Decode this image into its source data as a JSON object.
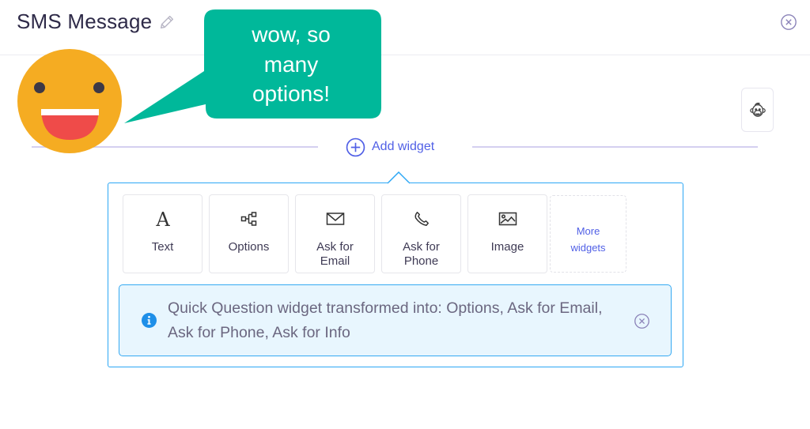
{
  "header": {
    "title": "SMS Message",
    "edit_icon": "pencil-icon",
    "close_icon": "close-circle-icon"
  },
  "annotation": {
    "bubble_lines": [
      "wow, so",
      "many",
      "options!"
    ],
    "emoji": "grinning-face",
    "colors": {
      "bubble": "#00b89a",
      "face": "#f5ac22",
      "mouth": "#ef4b49"
    }
  },
  "bot_button": {
    "icon": "monkey-icon"
  },
  "add_widget": {
    "label": "Add widget",
    "icon": "plus-circle-icon",
    "color": "#5160e6"
  },
  "widgets": [
    {
      "label": "Text",
      "icon": "letter-a-icon"
    },
    {
      "label": "Options",
      "icon": "options-tree-icon"
    },
    {
      "label": "Ask for Email",
      "icon": "envelope-icon"
    },
    {
      "label": "Ask for Phone",
      "icon": "phone-icon"
    },
    {
      "label": "Image",
      "icon": "image-icon"
    },
    {
      "label": "More widgets",
      "icon": ""
    }
  ],
  "info_banner": {
    "text": "Quick Question widget transformed into: Options, Ask for Email, Ask for Phone, Ask for Info",
    "icon": "info-icon",
    "close_icon": "close-circle-icon",
    "accent": "#2ca7f5"
  }
}
